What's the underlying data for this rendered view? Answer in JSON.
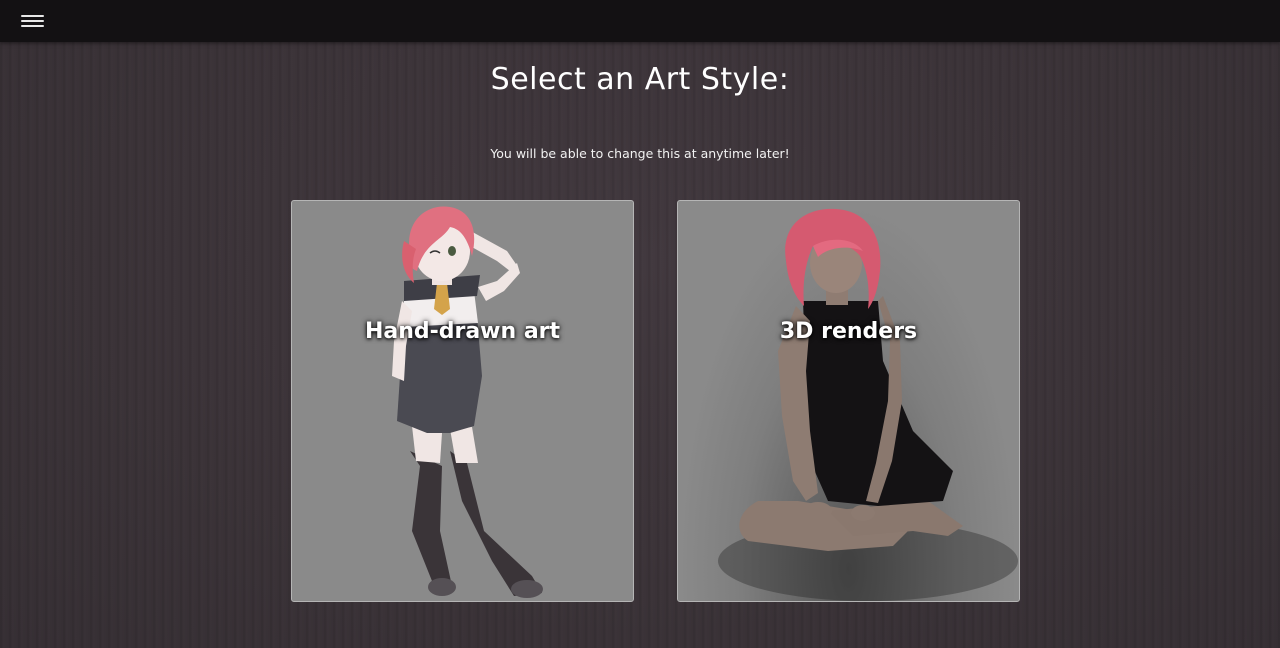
{
  "navbar": {
    "menu_icon": "hamburger-menu-icon"
  },
  "page": {
    "title": "Select an Art Style:",
    "subtitle": "You will be able to change this at anytime later!"
  },
  "options": [
    {
      "label": "Hand-drawn art",
      "image": "anime-character-illustration"
    },
    {
      "label": "3D renders",
      "image": "3d-rendered-character"
    }
  ],
  "colors": {
    "background": "#3b3338",
    "navbar": "#131113",
    "card": "#8a8a8a",
    "hair": "#e07080"
  }
}
